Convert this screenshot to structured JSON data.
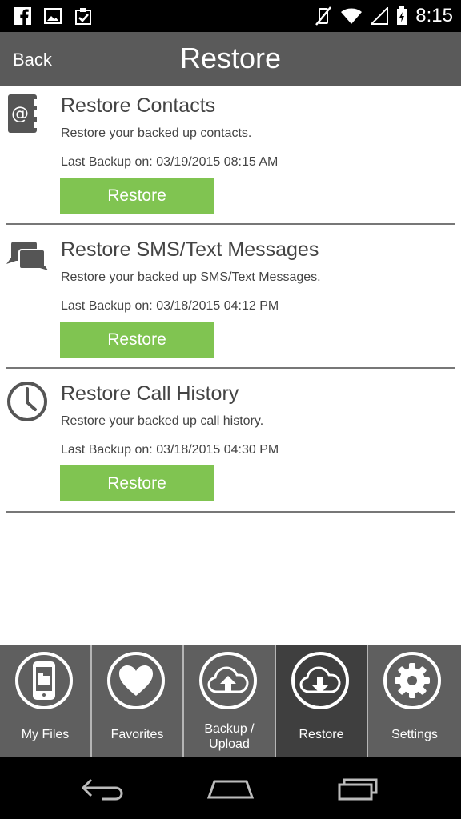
{
  "status_bar": {
    "time": "8:15"
  },
  "header": {
    "back_label": "Back",
    "title": "Restore"
  },
  "sections": [
    {
      "title": "Restore Contacts",
      "description": "Restore your backed up contacts.",
      "last_backup": "Last Backup on: 03/19/2015 08:15 AM",
      "button_label": "Restore",
      "icon": "contacts-book-icon"
    },
    {
      "title": "Restore SMS/Text Messages",
      "description": "Restore your backed up SMS/Text Messages.",
      "last_backup": "Last Backup on: 03/18/2015 04:12 PM",
      "button_label": "Restore",
      "icon": "chat-bubbles-icon"
    },
    {
      "title": "Restore Call History",
      "description": "Restore your backed up call history.",
      "last_backup": "Last Backup on: 03/18/2015 04:30 PM",
      "button_label": "Restore",
      "icon": "clock-icon"
    }
  ],
  "bottom_nav": {
    "items": [
      {
        "label": "My Files",
        "icon": "phone-folder-icon"
      },
      {
        "label": "Favorites",
        "icon": "heart-icon"
      },
      {
        "label_line1": "Backup /",
        "label_line2": "Upload",
        "icon": "cloud-upload-icon"
      },
      {
        "label": "Restore",
        "icon": "cloud-download-icon",
        "active": true
      },
      {
        "label": "Settings",
        "icon": "gear-icon"
      }
    ]
  },
  "colors": {
    "accent_green": "#80c451",
    "title_bar": "#5a5a5a",
    "nav_bg": "#5f5f5f",
    "nav_active": "#3f3f3f"
  }
}
